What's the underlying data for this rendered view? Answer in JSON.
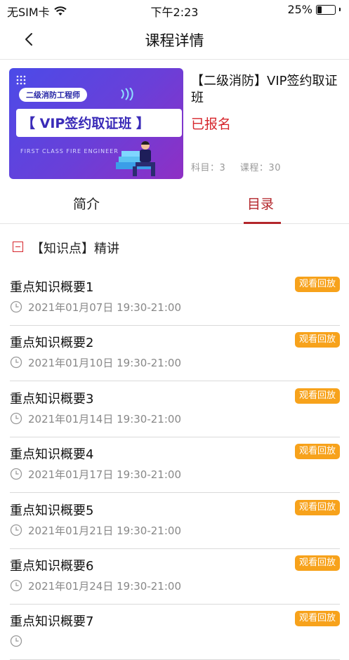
{
  "status_bar": {
    "carrier": "无SIM卡",
    "time": "下午2:23",
    "battery": "25%",
    "battery_level": 0.25
  },
  "nav": {
    "title": "课程详情",
    "back_icon": "chevron-left-icon"
  },
  "course": {
    "cover": {
      "tag": "二级消防工程师",
      "title": "【 VIP签约取证班 】",
      "subtitle": "FIRST CLASS FIRE ENGINEER"
    },
    "title": "【二级消防】VIP签约取证班",
    "status": "已报名",
    "subjects": "科目：3",
    "lessons": "课程：30"
  },
  "tabs": [
    {
      "label": "简介",
      "active": false
    },
    {
      "label": "目录",
      "active": true
    }
  ],
  "section": {
    "title": "【知识点】精讲",
    "icon": "collapse-minus-icon"
  },
  "lessons": [
    {
      "title": "重点知识概要1",
      "time": "2021年01月07日 19:30-21:00",
      "action": "观看回放"
    },
    {
      "title": "重点知识概要2",
      "time": "2021年01月10日 19:30-21:00",
      "action": "观看回放"
    },
    {
      "title": "重点知识概要3",
      "time": "2021年01月14日 19:30-21:00",
      "action": "观看回放"
    },
    {
      "title": "重点知识概要4",
      "time": "2021年01月17日 19:30-21:00",
      "action": "观看回放"
    },
    {
      "title": "重点知识概要5",
      "time": "2021年01月21日 19:30-21:00",
      "action": "观看回放"
    },
    {
      "title": "重点知识概要6",
      "time": "2021年01月24日 19:30-21:00",
      "action": "观看回放"
    },
    {
      "title": "重点知识概要7",
      "time": "",
      "action": "观看回放"
    }
  ],
  "colors": {
    "accent_red": "#d6252b",
    "tab_red": "#b3262b",
    "replay_orange": "#f7a21b"
  }
}
